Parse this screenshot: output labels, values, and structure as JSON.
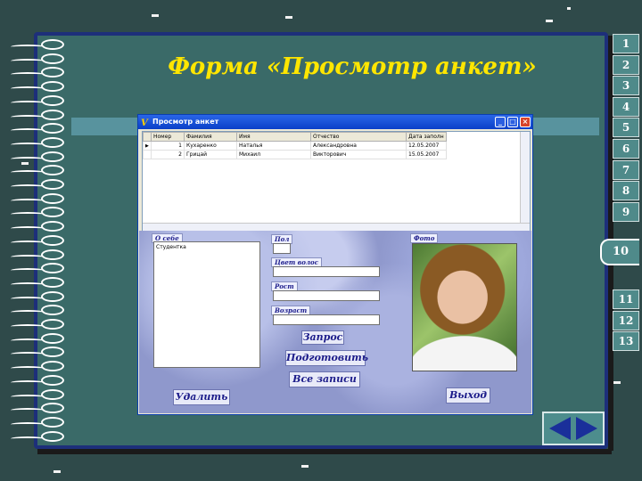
{
  "slide": {
    "title": "Форма «Просмотр анкет»",
    "nav_numbers": [
      "1",
      "2",
      "3",
      "4",
      "5",
      "6",
      "7",
      "8",
      "9"
    ],
    "nav_after": [
      "11",
      "12",
      "13"
    ],
    "current_number": "10"
  },
  "window": {
    "title": "Просмотр анкет",
    "icon": "V",
    "btn_min": "_",
    "btn_max": "□",
    "btn_close": "×"
  },
  "grid": {
    "columns": [
      "Номер",
      "Фамилия",
      "Имя",
      "Отчество",
      "Дата заполн"
    ],
    "rows": [
      {
        "num": "1",
        "last": "Кухаренко",
        "first": "Наталья",
        "middle": "Александровна",
        "date": "12.05.2007"
      },
      {
        "num": "2",
        "last": "Грицай",
        "first": "Михаил",
        "middle": "Викторович",
        "date": "15.05.2007"
      }
    ]
  },
  "form": {
    "about_label": "О себе",
    "about_value": "Студентка",
    "gender_label": "Пол",
    "hair_label": "Цвет волос",
    "height_label": "Рост",
    "age_label": "Возраст",
    "photo_label": "Фото",
    "btn_query": "Запрос",
    "btn_prepare": "Подготовить",
    "btn_all": "Все  записи",
    "btn_delete": "Удалить",
    "btn_exit": "Выход"
  },
  "colors": {
    "slide_bg": "#3a6a68",
    "title": "#ffe600",
    "nav_arrows": "#1a2f9a"
  }
}
